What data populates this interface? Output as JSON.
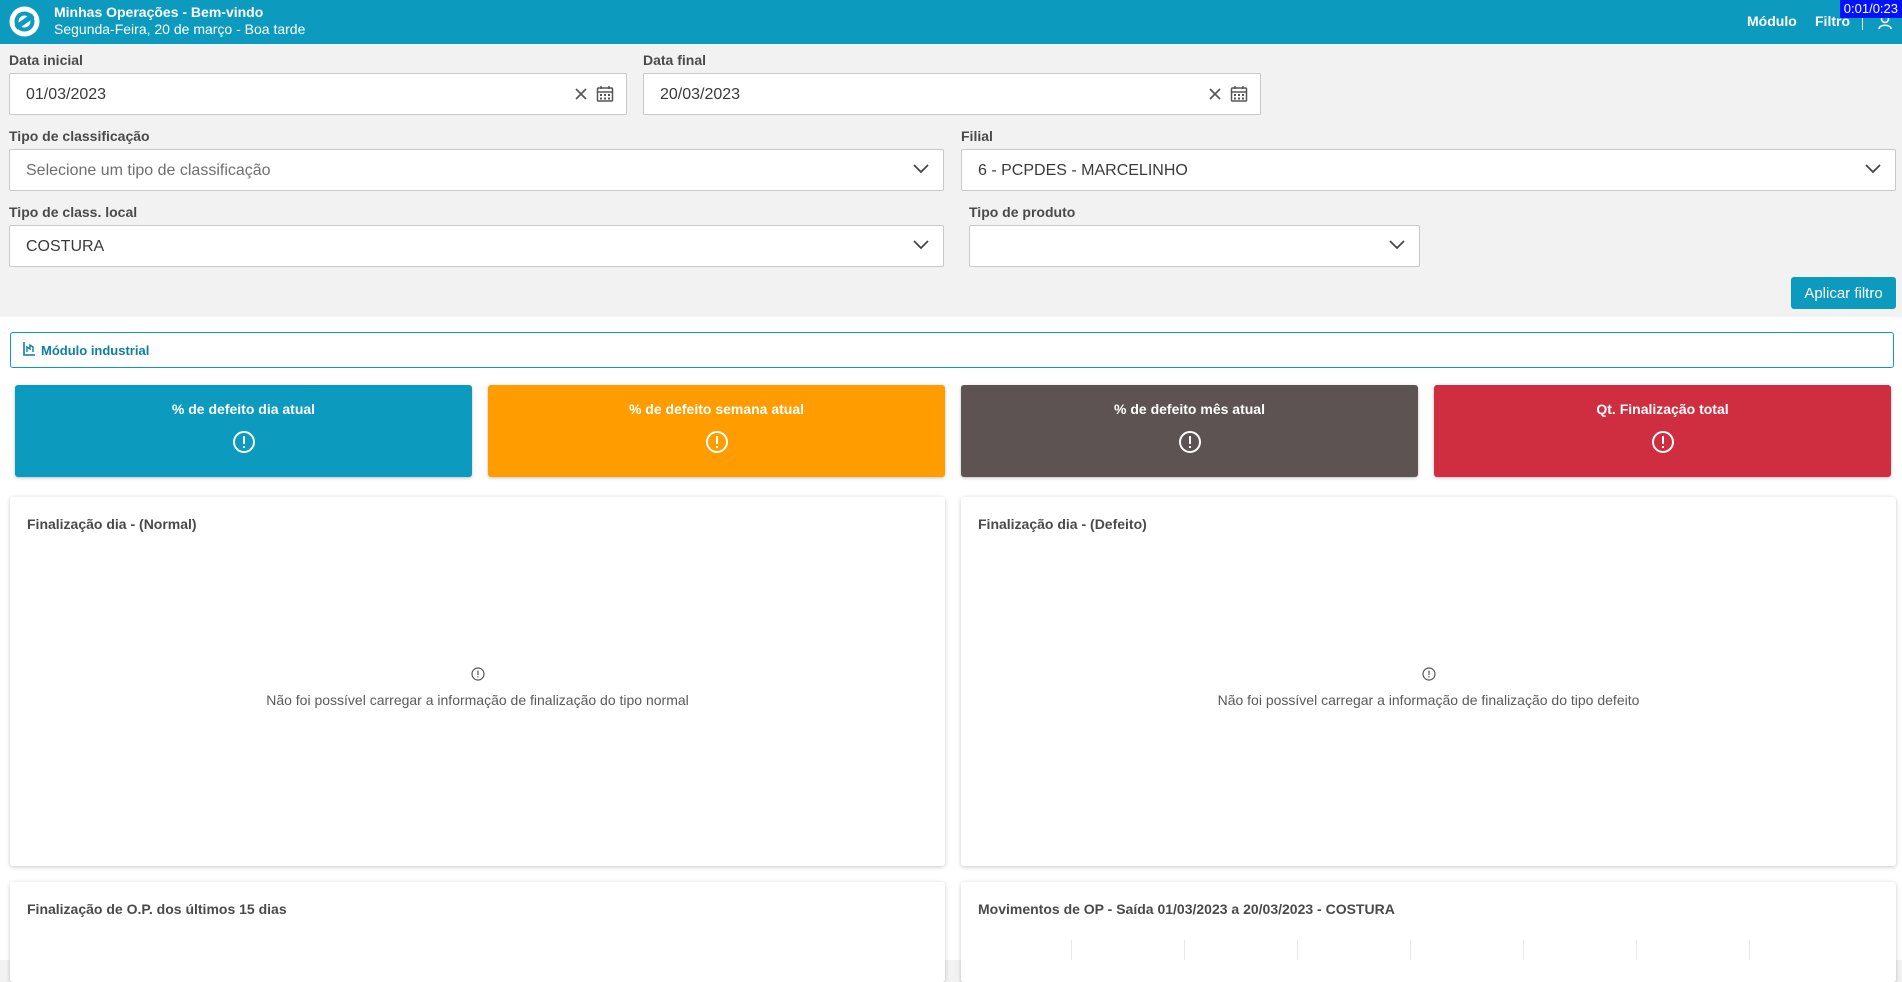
{
  "header": {
    "title": "Minhas Operações - Bem-vindo",
    "subtitle": "Segunda-Feira, 20 de março - Boa tarde",
    "nav_modulo": "Módulo",
    "nav_filtro": "Filtro",
    "timer": "0:01/0:23",
    "brand_color": "#0c9abe"
  },
  "filters": {
    "data_inicial": {
      "label": "Data inicial",
      "value": "01/03/2023"
    },
    "data_final": {
      "label": "Data final",
      "value": "20/03/2023"
    },
    "tipo_classificacao": {
      "label": "Tipo de classificação",
      "placeholder": "Selecione um tipo de classificação"
    },
    "filial": {
      "label": "Filial",
      "value": "6 - PCPDES - MARCELINHO"
    },
    "tipo_class_local": {
      "label": "Tipo de class. local",
      "value": "COSTURA"
    },
    "tipo_produto": {
      "label": "Tipo de produto",
      "value": ""
    },
    "apply_label": "Aplicar filtro"
  },
  "module": {
    "label": "Módulo industrial"
  },
  "kpis": [
    {
      "title": "% de defeito dia atual",
      "color": "#0c9abe"
    },
    {
      "title": "% de defeito semana atual",
      "color": "#ff9d00"
    },
    {
      "title": "% de defeito mês atual",
      "color": "#5c5352"
    },
    {
      "title": "Qt. Finalização total",
      "color": "#cf2d40"
    }
  ],
  "cards": {
    "normal": {
      "title": "Finalização dia - (Normal)",
      "error": "Não foi possível carregar a informação de finalização do tipo normal"
    },
    "defeito": {
      "title": "Finalização dia - (Defeito)",
      "error": "Não foi possível carregar a informação de finalização do tipo defeito"
    },
    "ultimos15": {
      "title": "Finalização de O.P. dos últimos 15 dias"
    },
    "movimentos": {
      "title": "Movimentos de OP - Saída 01/03/2023 a 20/03/2023 - COSTURA"
    }
  }
}
